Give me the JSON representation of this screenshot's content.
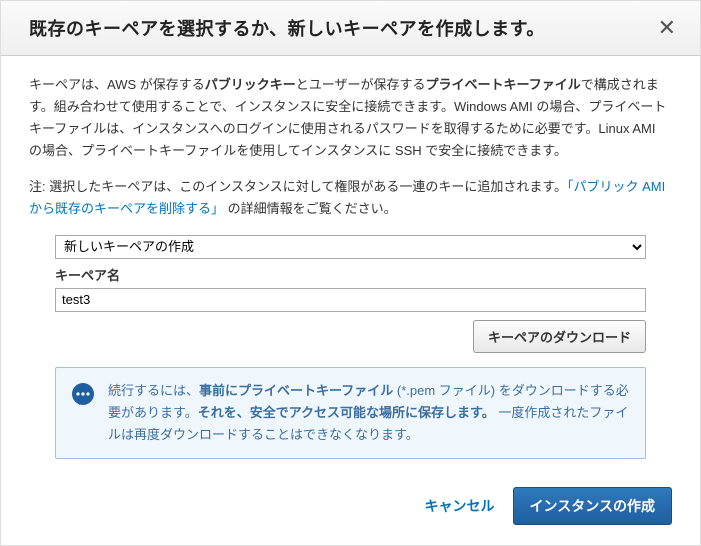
{
  "header": {
    "title": "既存のキーペアを選択するか、新しいキーペアを作成します。"
  },
  "body": {
    "para1_part1": "キーペアは、AWS が保存する",
    "para1_bold1": "パブリックキー",
    "para1_part2": "とユーザーが保存する",
    "para1_bold2": "プライベートキーファイル",
    "para1_part3": "で構成されます。組み合わせて使用することで、インスタンスに安全に接続できます。Windows AMI の場合、プライベートキーファイルは、インスタンスへのログインに使用されるパスワードを取得するために必要です。Linux AMI の場合、プライベートキーファイルを使用してインスタンスに SSH で安全に接続できます。",
    "para2_part1": "注: 選択したキーペアは、このインスタンスに対して権限がある一連のキーに追加されます。",
    "para2_link": "「パブリック AMI から既存のキーペアを削除する」",
    "para2_part2": " の詳細情報をご覧ください。"
  },
  "form": {
    "select_value": "新しいキーペアの作成",
    "keypair_label": "キーペア名",
    "keypair_value": "test3",
    "download_btn": "キーペアのダウンロード"
  },
  "info": {
    "part1": "続行するには、",
    "bold1": "事前にプライベートキーファイル",
    "part2": " (*.pem ファイル) をダウンロードする必要があります。",
    "bold2": "それを、安全でアクセス可能な場所に保存します。",
    "part3": " 一度作成されたファイルは再度ダウンロードすることはできなくなります。"
  },
  "footer": {
    "cancel": "キャンセル",
    "launch": "インスタンスの作成"
  }
}
